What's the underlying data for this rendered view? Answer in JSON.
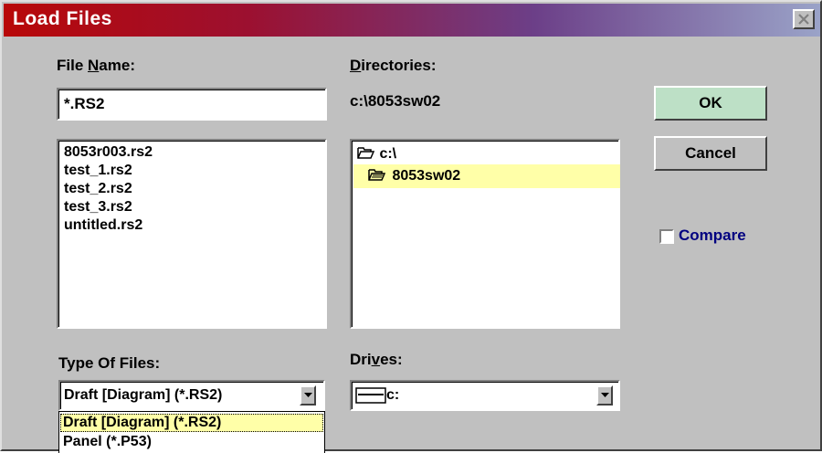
{
  "window": {
    "title": "Load Files"
  },
  "file_name": {
    "label_pre": "File ",
    "label_key": "N",
    "label_post": "ame:",
    "value": "*.RS2"
  },
  "files": [
    "8053r003.rs2",
    "test_1.rs2",
    "test_2.rs2",
    "test_3.rs2",
    "untitled.rs2"
  ],
  "directories": {
    "label_key": "D",
    "label_post": "irectories:",
    "current_path": "c:\\8053sw02",
    "items": [
      {
        "name": "c:\\",
        "selected": false
      },
      {
        "name": "8053sw02",
        "selected": true
      }
    ]
  },
  "buttons": {
    "ok": "OK",
    "cancel": "Cancel"
  },
  "compare": {
    "label": "Compare",
    "checked": false
  },
  "type_of_files": {
    "label": "Type Of Files:",
    "selected": "Draft [Diagram]  (*.RS2)",
    "options": [
      "Draft [Diagram]  (*.RS2)",
      "Panel (*.P53)"
    ]
  },
  "drives": {
    "label_pre": "Dri",
    "label_key": "v",
    "label_post": "es:",
    "selected": "c:"
  },
  "colors": {
    "selection_highlight": "#ffffa8",
    "ok_button": "#bde0c6",
    "compare_label": "#000080"
  }
}
